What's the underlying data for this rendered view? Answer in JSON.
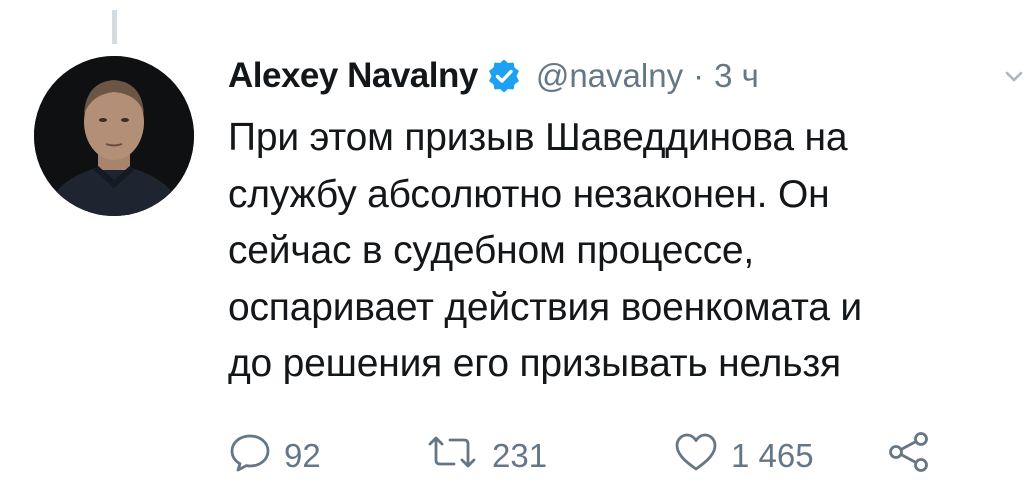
{
  "author": {
    "name": "Alexey Navalny",
    "handle": "@navalny",
    "separator": "·",
    "time": "3 ч"
  },
  "tweet": {
    "lines": [
      "При этом призыв Шаведдинова на",
      "службу абсолютно незаконен. Он",
      "сейчас в судебном процессе,",
      "оспаривает действия военкомата и",
      "до решения его призывать нельзя"
    ]
  },
  "actions": {
    "reply": {
      "icon": "reply-icon",
      "count": "92"
    },
    "retweet": {
      "icon": "retweet-icon",
      "count": "231"
    },
    "like": {
      "icon": "heart-icon",
      "count": "1 465"
    },
    "share": {
      "icon": "share-icon"
    }
  },
  "colors": {
    "text": "#14171a",
    "secondary": "#657786",
    "verified": "#1da1f2",
    "thread_line": "#d4dbe1"
  }
}
